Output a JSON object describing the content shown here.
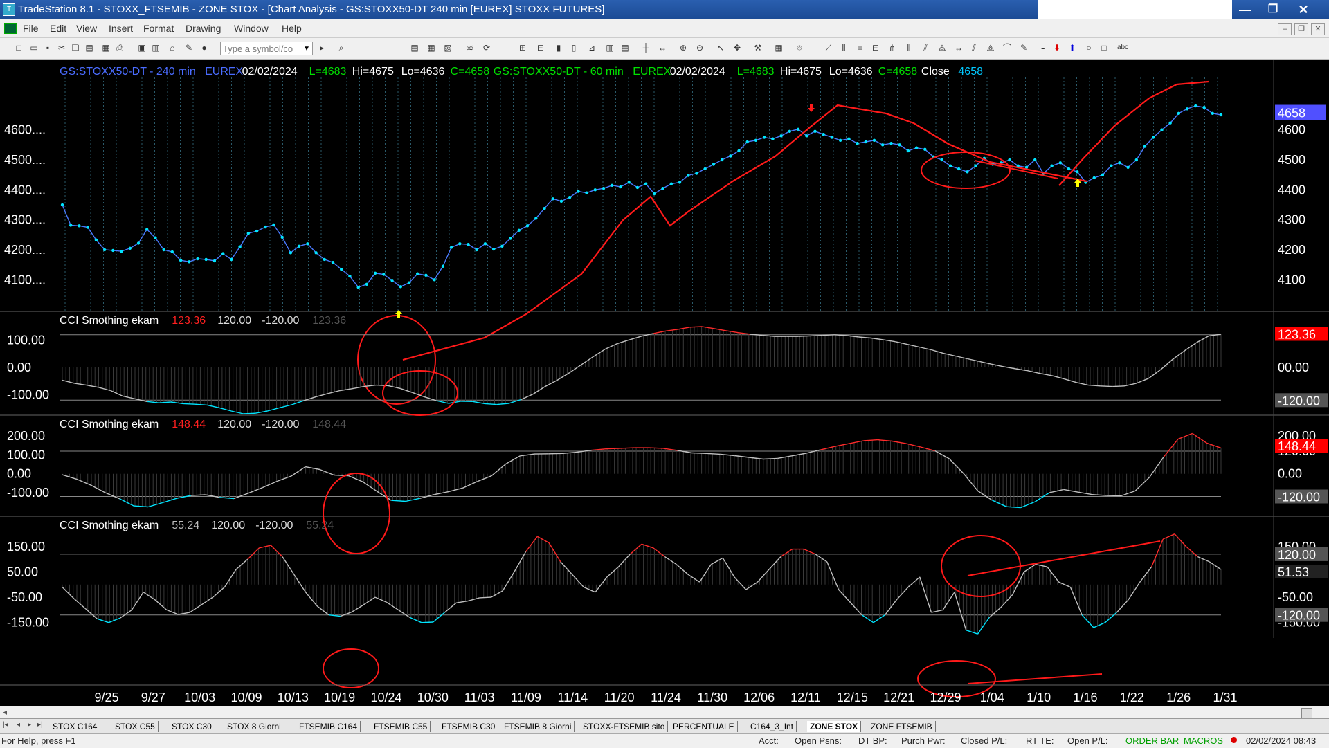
{
  "window": {
    "title": "TradeStation 8.1 - STOXX_FTSEMIB - ZONE STOX - [Chart Analysis - GS:STOXX50-DT  240 min  [EUREX] STOXX FUTURES]",
    "minimize": "—",
    "maximize": "❐",
    "close": "✕"
  },
  "menu": [
    "File",
    "Edit",
    "View",
    "Insert",
    "Format",
    "Drawing",
    "Window",
    "Help"
  ],
  "toolbar": {
    "symbol_placeholder": "Type a symbol/co"
  },
  "chart": {
    "header": [
      {
        "text": "GS:STOXX50-DT - 240 min",
        "color": "#4a6cff"
      },
      {
        "text": "EUREX",
        "color": "#4a6cff"
      },
      {
        "text": "02/02/2024",
        "color": "#ffffff"
      },
      {
        "text": "L=4683",
        "color": "#00e000"
      },
      {
        "text": "Hi=4675",
        "color": "#ffffff"
      },
      {
        "text": "Lo=4636",
        "color": "#ffffff"
      },
      {
        "text": "C=4658",
        "color": "#00e000"
      },
      {
        "text": "GS:STOXX50-DT - 60 min",
        "color": "#00e000"
      },
      {
        "text": "EUREX",
        "color": "#00e000"
      },
      {
        "text": "02/02/2024",
        "color": "#ffffff"
      },
      {
        "text": "L=4683",
        "color": "#00e000"
      },
      {
        "text": "Hi=4675",
        "color": "#ffffff"
      },
      {
        "text": "Lo=4636",
        "color": "#ffffff"
      },
      {
        "text": "C=4658",
        "color": "#00e000"
      },
      {
        "text": "Close",
        "color": "#ffffff"
      },
      {
        "text": "4658",
        "color": "#00c8ff"
      }
    ],
    "price_axis_left": [
      "4600....",
      "4500....",
      "4400....",
      "4300....",
      "4200....",
      "4100...."
    ],
    "price_axis_right": [
      "4600",
      "4500",
      "4400",
      "4300",
      "4200",
      "4100"
    ],
    "last_price_tag": "4658",
    "x_labels": [
      "9/25",
      "9/27",
      "10/03",
      "10/09",
      "10/13",
      "10/19",
      "10/24",
      "10/30",
      "11/03",
      "11/09",
      "11/14",
      "11/20",
      "11/24",
      "11/30",
      "12/06",
      "12/11",
      "12/15",
      "12/21",
      "12/29",
      "1/04",
      "1/10",
      "1/16",
      "1/22",
      "1/26",
      "1/31"
    ],
    "panels": [
      {
        "name": "CCI Smothing ekam",
        "value": "123.36",
        "value_color": "#ff2020",
        "upper": "120.00",
        "lower": "-120.00",
        "dim_value": "123.36",
        "left_axis": [
          "100.00",
          "0.00",
          "-100.00"
        ],
        "right_axis": [
          "00.00",
          "-120.00"
        ],
        "right_tag": "123.36"
      },
      {
        "name": "CCI Smothing ekam",
        "value": "148.44",
        "value_color": "#ff2020",
        "upper": "120.00",
        "lower": "-120.00",
        "dim_value": "148.44",
        "left_axis": [
          "200.00",
          "100.00",
          "0.00",
          "-100.00"
        ],
        "right_axis": [
          "200.00",
          "120.00",
          "0.00",
          "-120.00"
        ],
        "right_tag": "148.44"
      },
      {
        "name": "CCI Smothing ekam",
        "value": "55.24",
        "value_color": "#bbbbbb",
        "upper": "120.00",
        "lower": "-120.00",
        "dim_value": "55.24",
        "left_axis": [
          "150.00",
          "50.00",
          "-50.00",
          "-150.00"
        ],
        "right_axis": [
          "150.00",
          "-50.00",
          "-150.00"
        ],
        "right_tag_upper": "120.00",
        "right_tag": "51.53",
        "right_tag_lower": "-120.00"
      }
    ],
    "series": {
      "price": [
        4350,
        4282,
        4280,
        4275,
        4233,
        4200,
        4198,
        4195,
        4205,
        4222,
        4268,
        4240,
        4200,
        4193,
        4165,
        4160,
        4170,
        4168,
        4163,
        4187,
        4168,
        4210,
        4255,
        4262,
        4276,
        4283,
        4242,
        4190,
        4212,
        4220,
        4190,
        4168,
        4158,
        4135,
        4112,
        4075,
        4085,
        4122,
        4118,
        4098,
        4077,
        4090,
        4120,
        4115,
        4100,
        4145,
        4208,
        4220,
        4218,
        4200,
        4220,
        4202,
        4212,
        4238,
        4265,
        4280,
        4305,
        4338,
        4370,
        4362,
        4375,
        4395,
        4390,
        4400,
        4405,
        4415,
        4410,
        4425,
        4408,
        4420,
        4387,
        4405,
        4420,
        4425,
        4448,
        4455,
        4470,
        4485,
        4500,
        4513,
        4530,
        4560,
        4565,
        4575,
        4570,
        4580,
        4595,
        4602,
        4580,
        4595,
        4585,
        4575,
        4565,
        4570,
        4555,
        4560,
        4565,
        4550,
        4555,
        4550,
        4530,
        4540,
        4535,
        4510,
        4500,
        4480,
        4470,
        4460,
        4480,
        4505,
        4485,
        4490,
        4500,
        4480,
        4475,
        4500,
        4455,
        4480,
        4490,
        4470,
        4460,
        4425,
        4440,
        4450,
        4480,
        4490,
        4475,
        4500,
        4545,
        4575,
        4600,
        4623,
        4655,
        4670,
        4680,
        4675,
        4655,
        4650
      ],
      "cci1": [
        -47,
        -58,
        -65,
        -73,
        -85,
        -105,
        -115,
        -125,
        -130,
        -127,
        -133,
        -135,
        -138,
        -148,
        -160,
        -170,
        -168,
        -160,
        -148,
        -137,
        -122,
        -108,
        -96,
        -85,
        -78,
        -70,
        -65,
        -67,
        -77,
        -92,
        -108,
        -122,
        -132,
        -124,
        -125,
        -133,
        -136,
        -132,
        -118,
        -98,
        -70,
        -47,
        -20,
        10,
        40,
        68,
        88,
        102,
        115,
        125,
        134,
        140,
        148,
        150,
        143,
        135,
        128,
        122,
        118,
        114,
        114,
        114,
        116,
        118,
        120,
        117,
        112,
        108,
        102,
        95,
        85,
        75,
        65,
        52,
        42,
        32,
        22,
        12,
        3,
        -5,
        -12,
        -22,
        -30,
        -42,
        -55,
        -65,
        -68,
        -70,
        -68,
        -58,
        -40,
        -8,
        30,
        62,
        92,
        116,
        122
      ],
      "cci2": [
        -5,
        -28,
        -60,
        -100,
        -132,
        -170,
        -175,
        -153,
        -130,
        -115,
        -111,
        -125,
        -131,
        -103,
        -73,
        -40,
        -12,
        37,
        23,
        -7,
        -10,
        -42,
        -93,
        -141,
        -146,
        -130,
        -110,
        -95,
        -75,
        -41,
        -11,
        52,
        95,
        105,
        106,
        108,
        115,
        125,
        132,
        135,
        138,
        138,
        135,
        124,
        111,
        108,
        104,
        96,
        87,
        78,
        82,
        95,
        109,
        127,
        145,
        160,
        175,
        180,
        173,
        160,
        142,
        122,
        80,
        2,
        -91,
        -140,
        -174,
        -179,
        -148,
        -100,
        -83,
        -97,
        -110,
        -115,
        -117,
        -91,
        -18,
        90,
        184,
        214,
        163,
        137
      ],
      "cci3": [
        -10,
        -55,
        -95,
        -135,
        -150,
        -132,
        -100,
        -30,
        -60,
        -100,
        -118,
        -110,
        -80,
        -50,
        -10,
        60,
        100,
        145,
        155,
        110,
        40,
        -30,
        -85,
        -120,
        -125,
        -108,
        -80,
        -50,
        -70,
        -100,
        -130,
        -150,
        -148,
        -110,
        -72,
        -65,
        -52,
        -50,
        -25,
        50,
        130,
        190,
        165,
        90,
        40,
        -10,
        -30,
        30,
        70,
        120,
        160,
        145,
        110,
        80,
        40,
        10,
        80,
        105,
        30,
        -20,
        10,
        60,
        110,
        140,
        140,
        120,
        90,
        -20,
        -70,
        -120,
        -150,
        -120,
        -60,
        -10,
        30,
        -110,
        -100,
        -30,
        -180,
        -195,
        -130,
        -90,
        -40,
        50,
        80,
        70,
        10,
        -10,
        -120,
        -170,
        -150,
        -110,
        -60,
        10,
        70,
        180,
        200,
        150,
        110,
        90,
        60
      ]
    },
    "colors": {
      "price_line": "#4a7aff",
      "price_point": "#00e5ff",
      "annotation": "#ff1a1a",
      "cci_line": "#c0c0c0",
      "cci_high": "#ff2a2a",
      "cci_low": "#00e5ff",
      "tag_red": "#ff0000",
      "tag_blue": "#5050ff",
      "tag_gray": "#555555"
    }
  },
  "scrollbar": {
    "left": "◂",
    "right": "▸"
  },
  "tabs": [
    "STOX C164",
    "STOX C55",
    "STOX  C30",
    "STOX  8 Giorni",
    "FTSEMIB C164",
    "FTSEMIB C55",
    "FTSEMIB C30",
    "FTSEMIB  8 Giorni",
    "STOXX-FTSEMIB sito",
    "PERCENTUALE",
    "C164_3_Int",
    "ZONE STOX",
    "ZONE FTSEMIB"
  ],
  "active_tab": "ZONE STOX",
  "status": {
    "help": "For Help, press F1",
    "acct": "Acct:",
    "open_psns": "Open Psns:",
    "dt_bp": "DT BP:",
    "purch_pwr": "Purch Pwr:",
    "closed_pl": "Closed P/L:",
    "rt_te": "RT TE:",
    "open_pl": "Open P/L:",
    "order_bar": "ORDER BAR",
    "macros": "MACROS",
    "datetime": "02/02/2024 08:43"
  }
}
